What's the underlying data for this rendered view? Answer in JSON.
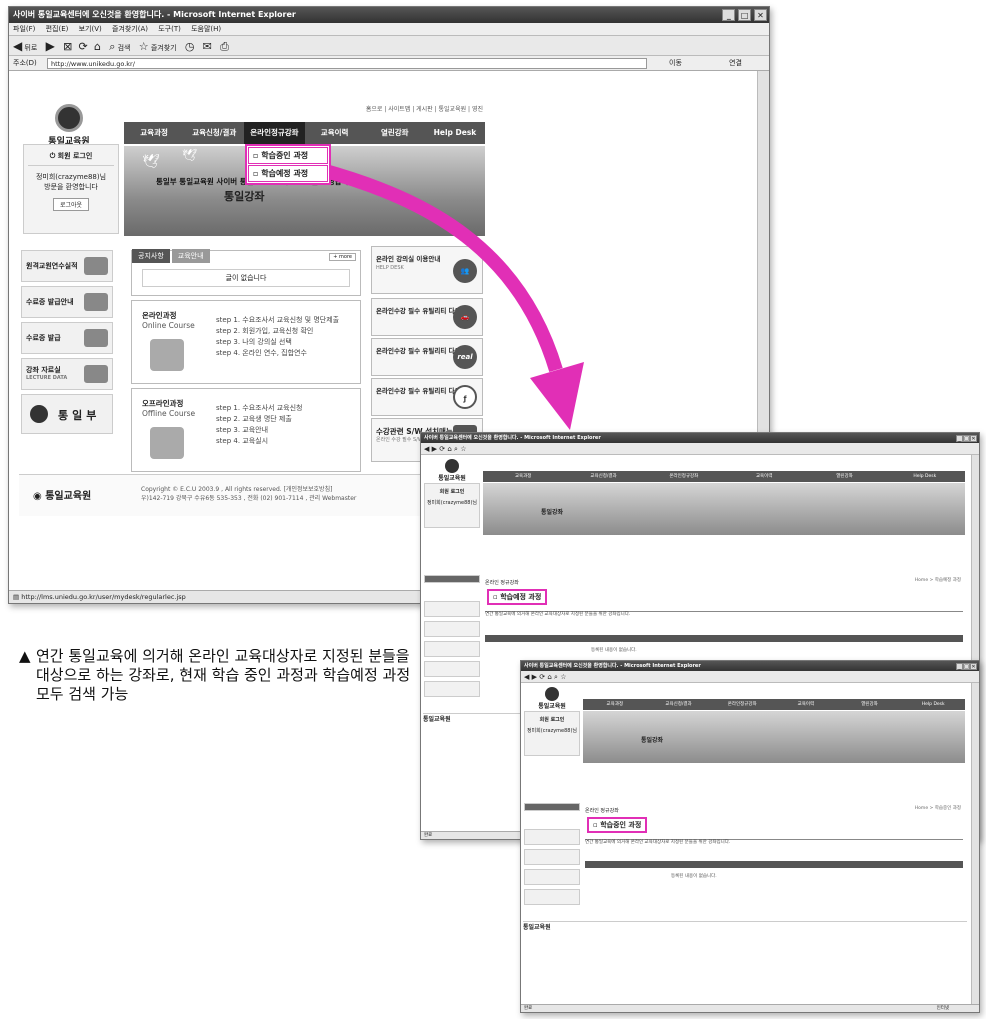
{
  "main_window": {
    "title": "사이버 통일교육센터에 오신것을 환영합니다. - Microsoft Internet Explorer",
    "menu": [
      "파일(F)",
      "편집(E)",
      "보기(V)",
      "즐겨찾기(A)",
      "도구(T)",
      "도움말(H)"
    ],
    "toolbar": {
      "back": "뒤로",
      "search": "검색",
      "favorites": "즐겨찾기"
    },
    "address_label": "주소(D)",
    "url": "http://www.unikedu.go.kr/",
    "go_label": "이동",
    "links_label": "연결",
    "status": "http://lms.uniedu.go.kr/user/mydesk/regularlec.jsp"
  },
  "site": {
    "logo_text": "통일교육원",
    "top_links": "홈으로 | 사이트맵 | 게시판 | 통일교육원 | 영진",
    "nav": [
      "교육과정",
      "교육신청/결과",
      "온라인정규강좌",
      "교육이력",
      "열린강좌",
      "Help Desk"
    ],
    "dropdown": [
      "학습중인 과정",
      "학습예정 과정"
    ],
    "login_title": "회원 로그인",
    "login_user": "정미희(crazyme88)님",
    "login_welcome": "방문을 환영합니다",
    "logout": "로그아웃",
    "hero_line": "통일부 통일교육원 사이버 통일교육센터에 오신것을 환영합니다",
    "hero_title": "통일강좌",
    "side_menu": [
      "원격교원연수실적",
      "수료증 발급안내",
      "수료증 발급",
      "강좌 자료실",
      "통일부"
    ],
    "side_sub": "LECTURE DATA",
    "notice_tabs": [
      "공지사항",
      "교육안내"
    ],
    "notice_more": "more",
    "notice_empty": "글이 없습니다",
    "online_course": {
      "name_ko": "온라인과정",
      "name_en": "Online Course",
      "steps": [
        "step 1. 수요조사서 교육신청 및 명단제출",
        "step 2. 회원가입, 교육신청 확인",
        "step 3. 나의 강의실 선택",
        "step 4. 온라인 연수, 집합연수"
      ]
    },
    "offline_course": {
      "name_ko": "오프라인과정",
      "name_en": "Offline Course",
      "steps": [
        "step 1. 수요조사서 교육신청",
        "step 2. 교육생 명단 제출",
        "step 3. 교육안내",
        "step 4. 교육실시"
      ]
    },
    "right_boxes": [
      {
        "title": "온라인 강의실 이용안내",
        "sub": "HELP DESK",
        "icon": "people-icon"
      },
      {
        "title": "온라인수강 필수 유틸리티 다운로드",
        "sub": "",
        "icon": "car-icon"
      },
      {
        "title": "온라인수강 필수 유틸리티 다운로드",
        "sub": "",
        "icon": "real"
      },
      {
        "title": "온라인수강 필수 유틸리티 다운로드",
        "sub": "",
        "icon": "flash-icon"
      },
      {
        "title": "수강관련 S/W 설치매뉴얼",
        "sub": "온라인 수강 필수 S/W",
        "icon": "box-icon"
      }
    ],
    "footer_logo": "통일교육원",
    "copyright": "Copyright © E.C.U 2003.9 , All rights reserved.   [개인정보보호방침]",
    "address": "우)142-719 강북구 수유6동 535-353 , 전화 (02) 901-7114 ,   관리 Webmaster"
  },
  "caption": {
    "marker": "▲",
    "text": "연간 통일교육에 의거해 온라인 교육대상자로 지정된 분들을 대상으로 하는 강좌로, 현재 학습 중인 과정과 학습예정 과정 모두 검색 가능"
  },
  "window2": {
    "title": "사이버 통일교육센터에 오신것을 환영합니다. - Microsoft Internet Explorer",
    "section": "온라인 정규강좌",
    "page_title": "학습예정 과정",
    "breadcrumb": "Home > 학습예정 과정",
    "intro": "연간 통일교육에 의거해 온라인 교육대상자로 지정된 분들을 위한 강좌입니다.",
    "empty": "등록된 내용이 없습니다.",
    "status": "완료"
  },
  "window3": {
    "title": "사이버 통일교육센터에 오신것을 환영합니다. - Microsoft Internet Explorer",
    "section": "온라인 정규강좌",
    "page_title": "학습중인 과정",
    "breadcrumb": "Home > 학습중인 과정",
    "intro": "연간 통일교육에 의거해 온라인 교육대상자로 지정된 분들을 위한 강좌입니다.",
    "empty": "등록된 내용이 없습니다.",
    "status": "완료",
    "status_right": "인터넷"
  },
  "colors": {
    "highlight": "#e12fb6",
    "nav": "#555555",
    "titlebar": "#444444"
  }
}
